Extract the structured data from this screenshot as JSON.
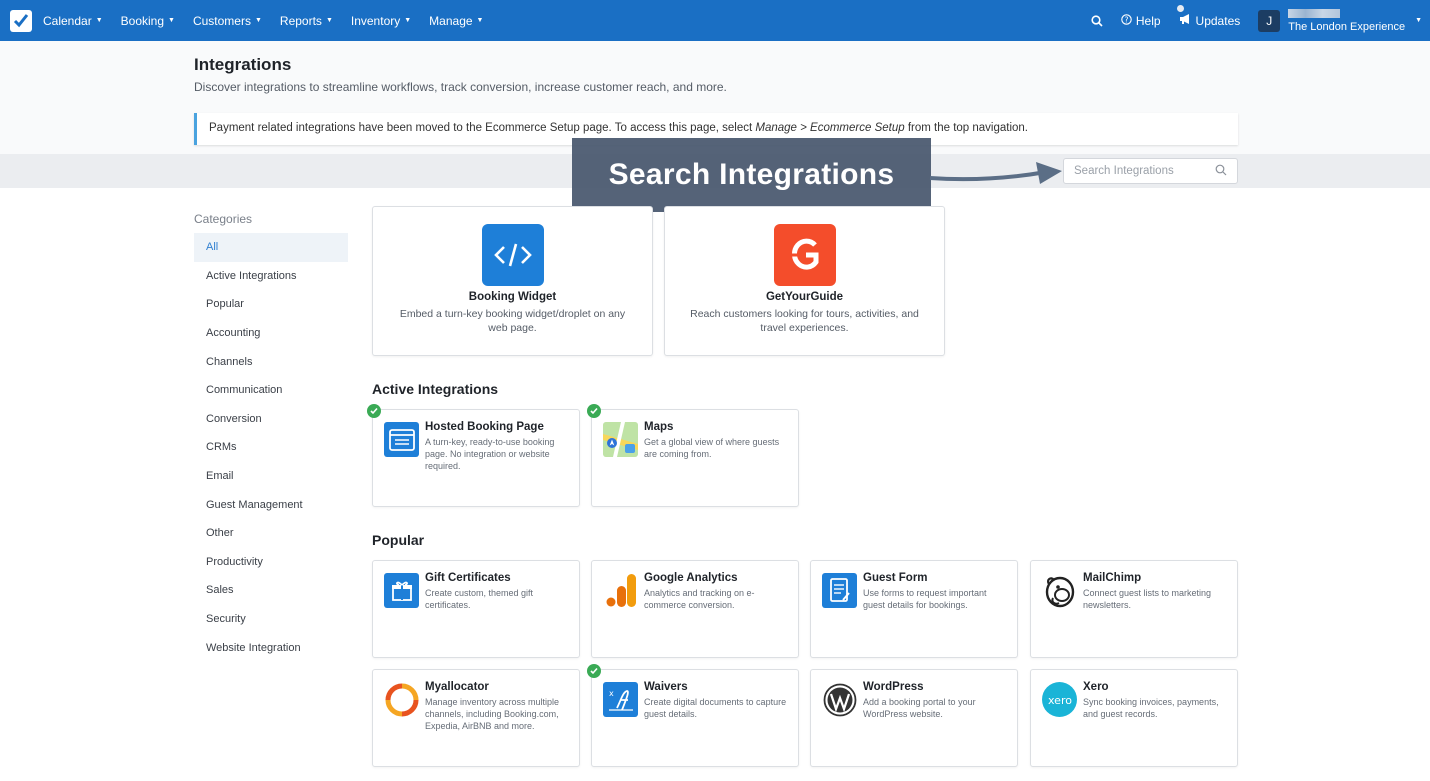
{
  "nav": {
    "items": [
      "Calendar",
      "Booking",
      "Customers",
      "Reports",
      "Inventory",
      "Manage"
    ],
    "help": "Help",
    "updates": "Updates",
    "avatar_letter": "J",
    "account_name": "The London Experience"
  },
  "header": {
    "title": "Integrations",
    "subtitle": "Discover integrations to streamline workflows, track conversion, increase customer reach, and more.",
    "notice_prefix": "Payment related integrations have been moved to the Ecommerce Setup page. To access this page, select ",
    "notice_path": "Manage > Ecommerce Setup",
    "notice_suffix": " from the top navigation."
  },
  "search": {
    "placeholder": "Search Integrations",
    "callout": "Search Integrations"
  },
  "sidebar": {
    "title": "Categories",
    "items": [
      "All",
      "Active Integrations",
      "Popular",
      "Accounting",
      "Channels",
      "Communication",
      "Conversion",
      "CRMs",
      "Email",
      "Guest Management",
      "Other",
      "Productivity",
      "Sales",
      "Security",
      "Website Integration"
    ],
    "active": "All"
  },
  "featured": [
    {
      "title": "Booking Widget",
      "desc": "Embed a turn-key booking widget/droplet on any web page.",
      "icon": "code-icon",
      "color": "#1e7fd8"
    },
    {
      "title": "GetYourGuide",
      "desc": "Reach customers looking for tours, activities, and travel experiences.",
      "icon": "getyourguide-logo-icon",
      "color": "#f44d2b"
    }
  ],
  "sections": {
    "active_title": "Active Integrations",
    "popular_title": "Popular"
  },
  "active": [
    {
      "title": "Hosted Booking Page",
      "desc": "A turn-key, ready-to-use booking page. No integration or website required."
    },
    {
      "title": "Maps",
      "desc": "Get a global view of where guests are coming from."
    }
  ],
  "popular": [
    {
      "title": "Gift Certificates",
      "desc": "Create custom, themed gift certificates."
    },
    {
      "title": "Google Analytics",
      "desc": "Analytics and tracking on e-commerce conversion."
    },
    {
      "title": "Guest Form",
      "desc": "Use forms to request important guest details for bookings."
    },
    {
      "title": "MailChimp",
      "desc": "Connect guest lists to marketing newsletters."
    },
    {
      "title": "Myallocator",
      "desc": "Manage inventory across multiple channels, including Booking.com, Expedia, AirBNB and more."
    },
    {
      "title": "Waivers",
      "desc": "Create digital documents to capture guest details."
    },
    {
      "title": "WordPress",
      "desc": "Add a booking portal to your WordPress website."
    },
    {
      "title": "Xero",
      "desc": "Sync booking invoices, payments, and guest records."
    }
  ],
  "colors": {
    "topbar": "#1a6fc4",
    "active_check": "#3aaa55",
    "accent": "#2f7fd0"
  }
}
